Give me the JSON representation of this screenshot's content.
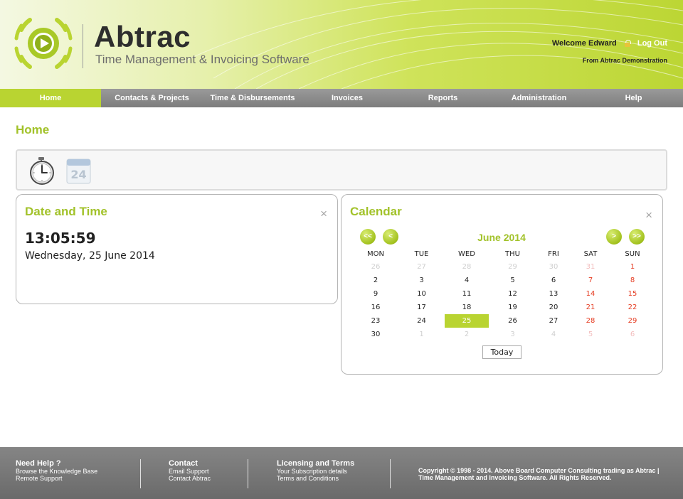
{
  "header": {
    "brand": "Abtrac",
    "tagline": "Time Management & Invoicing Software",
    "welcome": "Welcome Edward",
    "logout": "Log Out",
    "organisation": "From Abtrac Demonstration"
  },
  "nav": {
    "items": [
      {
        "label": "Home",
        "active": true
      },
      {
        "label": "Contacts & Projects"
      },
      {
        "label": "Time & Disbursements"
      },
      {
        "label": "Invoices"
      },
      {
        "label": "Reports"
      },
      {
        "label": "Administration"
      },
      {
        "label": "Help"
      }
    ]
  },
  "page": {
    "title": "Home"
  },
  "toolbar": {
    "icons": [
      "stopwatch-icon",
      "calendar-icon"
    ],
    "calendar_icon_day": "24"
  },
  "datetime": {
    "title": "Date and Time",
    "close": "×",
    "time": "13:05:59",
    "date": "Wednesday, 25 June 2014"
  },
  "calendar": {
    "title": "Calendar",
    "close": "×",
    "month": "June 2014",
    "prev_year": "<<",
    "prev_month": "<",
    "next_month": ">",
    "next_year": ">>",
    "weekdays": [
      "MON",
      "TUE",
      "WED",
      "THU",
      "FRI",
      "SAT",
      "SUN"
    ],
    "weeks": [
      [
        "26",
        "27",
        "28",
        "29",
        "30",
        "31",
        "1"
      ],
      [
        "2",
        "3",
        "4",
        "5",
        "6",
        "7",
        "8"
      ],
      [
        "9",
        "10",
        "11",
        "12",
        "13",
        "14",
        "15"
      ],
      [
        "16",
        "17",
        "18",
        "19",
        "20",
        "21",
        "22"
      ],
      [
        "23",
        "24",
        "25",
        "26",
        "27",
        "28",
        "29"
      ],
      [
        "30",
        "1",
        "2",
        "3",
        "4",
        "5",
        "6"
      ]
    ],
    "selected_day": "25",
    "today_button": "Today",
    "colors": {
      "accent": "#b9d431",
      "weekend": "#e53c22",
      "other_month": "#cfcfcf"
    }
  },
  "footer": {
    "help": {
      "heading": "Need Help ?",
      "links": [
        "Browse the Knowledge Base",
        "Remote Support"
      ]
    },
    "contact": {
      "heading": "Contact",
      "links": [
        "Email Support",
        "Contact Abtrac"
      ]
    },
    "licensing": {
      "heading": "Licensing and Terms",
      "links": [
        "Your Subscription details",
        "Terms and Conditions"
      ]
    },
    "copyright": "Copyright © 1998 - 2014. Above Board Computer Consulting trading as Abtrac | Time Management and Invoicing Software. All Rights Reserved."
  }
}
